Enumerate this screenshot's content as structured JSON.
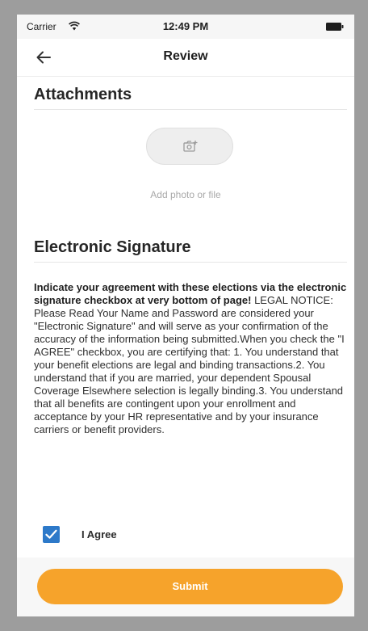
{
  "status_bar": {
    "carrier": "Carrier",
    "time": "12:49 PM",
    "wifi_icon": "wifi-icon",
    "battery_icon": "battery-icon"
  },
  "nav": {
    "back_icon": "arrow-left-icon",
    "title": "Review"
  },
  "attachments": {
    "title": "Attachments",
    "button_icon": "add-photo-icon",
    "label": "Add photo or file"
  },
  "signature": {
    "title": "Electronic Signature",
    "intro": "Indicate your agreement with these elections via the electronic signature checkbox at very bottom of page!",
    "legal_text": "LEGAL NOTICE: Please Read Your Name and Password are considered your \"Electronic Signature\" and will serve as your confirmation of the accuracy of the information being submitted.When you check the \"I AGREE\" checkbox, you are certifying that: 1. You understand that your benefit elections are legal and binding transactions.2. You understand that if you are married, your dependent Spousal Coverage Elsewhere selection is legally binding.3. You understand that all benefits are contingent upon your enrollment and acceptance by your HR representative and by your insurance carriers or benefit providers.",
    "agree_label": "I Agree",
    "agree_checked": true
  },
  "footer": {
    "submit_label": "Submit"
  },
  "colors": {
    "accent": "#f6a32b",
    "checkbox": "#2d79c9"
  }
}
